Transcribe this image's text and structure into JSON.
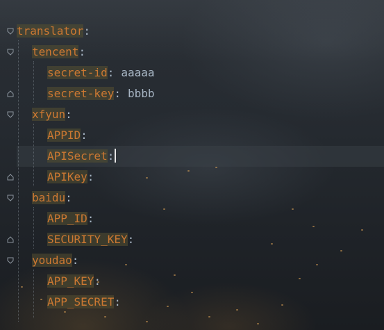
{
  "editor": {
    "lines": [
      {
        "key": "translator",
        "value": ""
      },
      {
        "key": "tencent",
        "value": ""
      },
      {
        "key": "secret-id",
        "value": "aaaaa"
      },
      {
        "key": "secret-key",
        "value": "bbbb"
      },
      {
        "key": "xfyun",
        "value": ""
      },
      {
        "key": "APPID",
        "value": ""
      },
      {
        "key": "APISecret",
        "value": ""
      },
      {
        "key": "APIKey",
        "value": ""
      },
      {
        "key": "baidu",
        "value": ""
      },
      {
        "key": "APP_ID",
        "value": ""
      },
      {
        "key": "SECURITY_KEY",
        "value": ""
      },
      {
        "key": "youdao",
        "value": ""
      },
      {
        "key": "APP_KEY",
        "value": ""
      },
      {
        "key": "APP_SECRET",
        "value": ""
      }
    ],
    "colon": ":",
    "fold_icons": [
      "fold-collapse-icon",
      "fold-end-icon"
    ],
    "colors": {
      "key": "#cc7832",
      "key_highlight": "#55503280",
      "text": "#a9b7c6",
      "caret": "#e6e6e6"
    }
  }
}
